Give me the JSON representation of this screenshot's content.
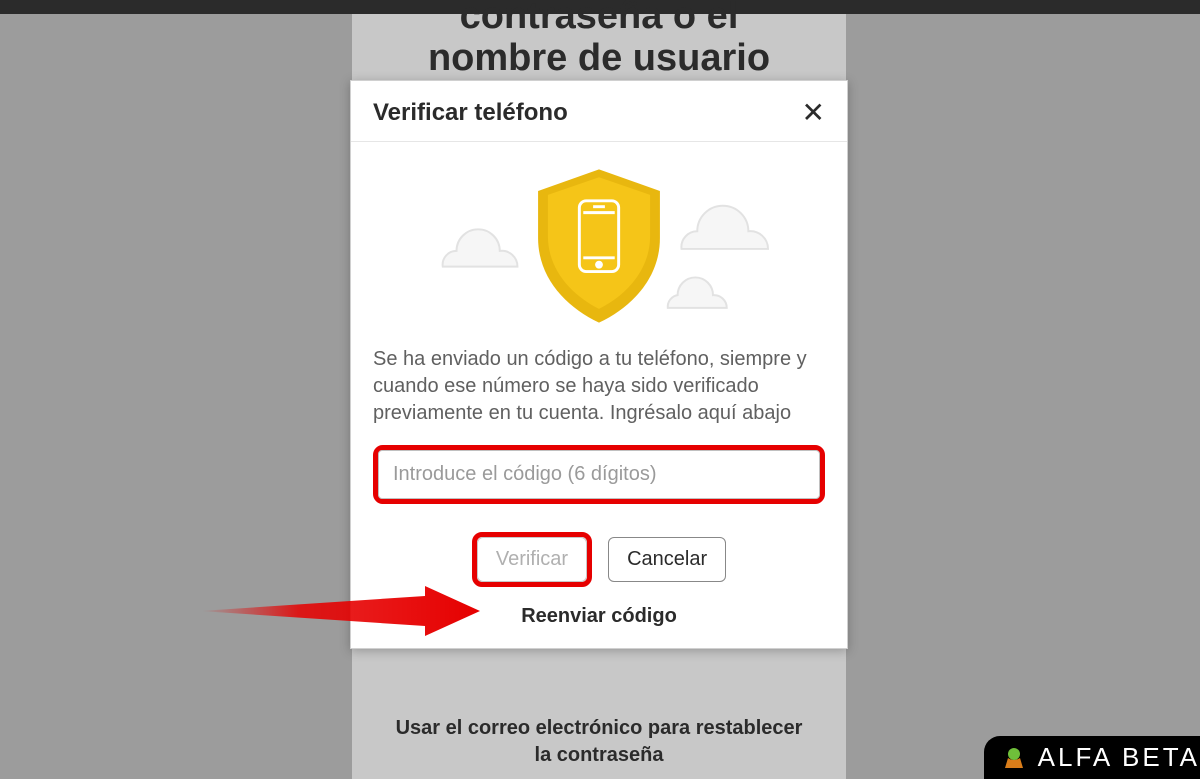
{
  "background": {
    "title_line1": "contraseña o el",
    "title_line2": "nombre de usuario",
    "footer_line1": "Usar el correo electrónico para restablecer",
    "footer_line2": "la contraseña"
  },
  "modal": {
    "title": "Verificar teléfono",
    "instruction": "Se ha enviado un código a tu teléfono, siempre y cuando ese número se haya sido verificado previamente en tu cuenta. Ingrésalo aquí abajo",
    "input_placeholder": "Introduce el código (6 dígitos)",
    "verify_label": "Verificar",
    "cancel_label": "Cancelar",
    "resend_label": "Reenviar código"
  },
  "watermark": {
    "text": "ALFA BETA"
  }
}
